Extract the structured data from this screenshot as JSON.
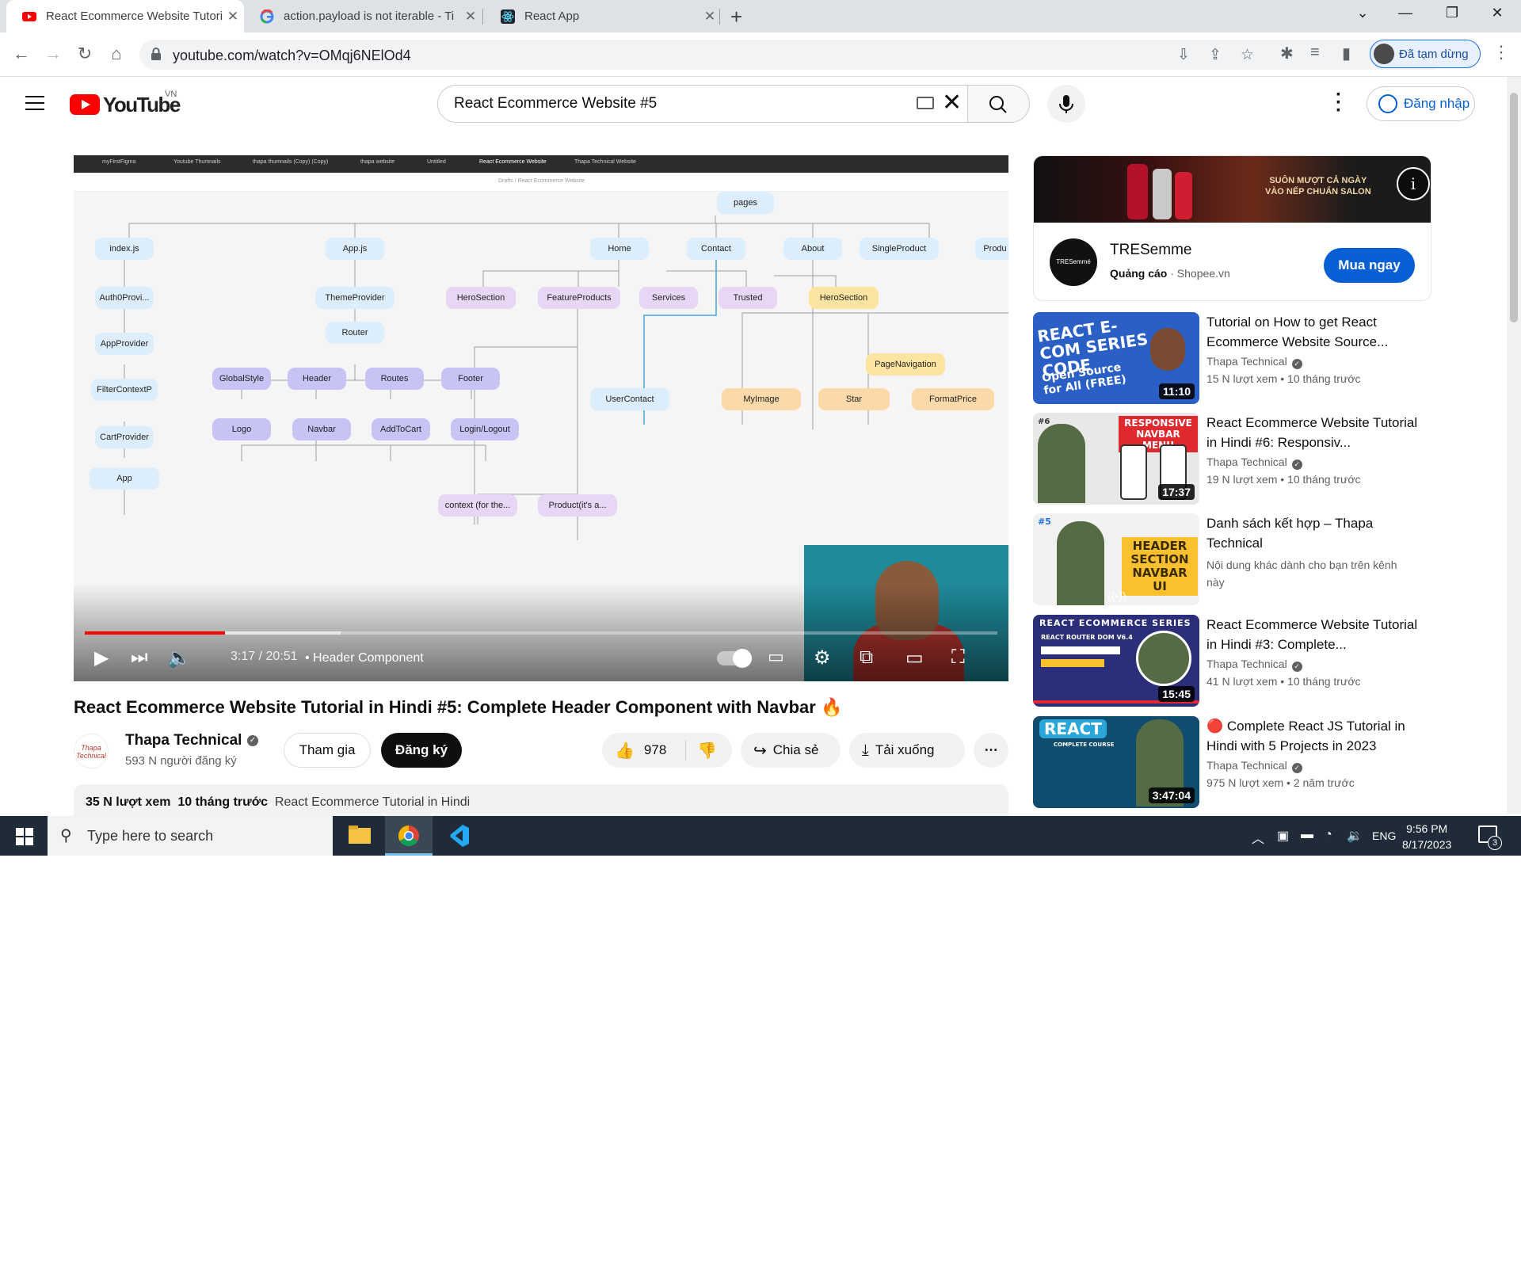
{
  "browser": {
    "tabs": [
      {
        "title": "React Ecommerce Website Tutori",
        "active": true,
        "icon": "youtube-icon"
      },
      {
        "title": "action.payload is not iterable - Ti",
        "active": false,
        "icon": "google-icon"
      },
      {
        "title": "React App",
        "active": false,
        "icon": "react-icon"
      }
    ],
    "url_host": "youtube.com",
    "url_path": "/watch?v=OMqj6NElOd4",
    "profile_label": "Đã tạm dừng"
  },
  "youtube": {
    "logo_text": "YouTube",
    "country": "VN",
    "search_value": "React Ecommerce Website #5",
    "signin_label": "Đăng nhập"
  },
  "player": {
    "figma_tabs": [
      "myFirstFigma",
      "Youtube Thumnails",
      "thapa thumnails (Copy) (Copy)",
      "thapa website",
      "Untitled",
      "React Ecommerce Website",
      "Thapa Technical Website"
    ],
    "figma_breadcrumb": "Drafts / React Ecommerce Website",
    "nodes": {
      "pages": "pages",
      "index": "index.js",
      "app": "App.js",
      "home": "Home",
      "contact": "Contact",
      "about": "About",
      "single": "SingleProduct",
      "prod": "Produ",
      "auth": "Auth0Provi...",
      "theme": "ThemeProvider",
      "hero1": "HeroSection",
      "feature": "FeatureProducts",
      "services": "Services",
      "trusted": "Trusted",
      "hero2": "HeroSection",
      "appprov": "AppProvider",
      "router": "Router",
      "pagenav": "PageNavigation",
      "filter": "FilterContextP",
      "globalstyle": "GlobalStyle",
      "header": "Header",
      "routes": "Routes",
      "footer": "Footer",
      "usercontact": "UserContact",
      "myimage": "MyImage",
      "star": "Star",
      "formatprice": "FormatPrice",
      "cart": "CartProvider",
      "logo": "Logo",
      "navbar": "Navbar",
      "addtocart": "AddToCart",
      "login": "Login/Logout",
      "appnode": "App",
      "context": "context (for the...",
      "product": "Product(it's a..."
    },
    "time": "3:17 / 20:51",
    "chapter": "• Header Component",
    "progress_fraction": 0.154
  },
  "video": {
    "title": "React Ecommerce Website Tutorial in Hindi #5: Complete Header Component with Navbar 🔥",
    "channel": "Thapa Technical",
    "avatar_text": "Thapa Technical",
    "subscribers": "593 N người đăng ký",
    "join_label": "Tham gia",
    "subscribe_label": "Đăng ký",
    "likes": "978",
    "share_label": "Chia sẻ",
    "download_label": "Tải xuống",
    "views": "35 N lượt xem",
    "date": "10 tháng trước",
    "playlist_tag": "React Ecommerce Tutorial in Hindi"
  },
  "ad": {
    "banner_line1": "SUÔN MƯỢT CẢ NGÀY",
    "banner_line2": "VÀO NẾP CHUẨN SALON",
    "logo_text": "TRESemmé",
    "name": "TRESemme",
    "label": "Quảng cáo",
    "source": "· Shopee.vn",
    "cta": "Mua ngay"
  },
  "recommendations": [
    {
      "title": "Tutorial on How to get React Ecommerce Website Source...",
      "channel": "Thapa Technical",
      "stats": "15 N lượt xem  •  10 tháng trước",
      "duration": "11:10",
      "thumb_text": "REACT E-COM SERIES CODE",
      "thumb_sub": "Open Source for All (FREE)"
    },
    {
      "title": "React Ecommerce Website Tutorial in Hindi #6: Responsiv...",
      "channel": "Thapa Technical",
      "stats": "19 N lượt xem  •  10 tháng trước",
      "duration": "17:37",
      "thumb_text": "RESPONSIVE NAVBAR MENU",
      "thumb_sub": "#6"
    },
    {
      "title": "Danh sách kết hợp – Thapa Technical",
      "desc": "Nội dung khác dành cho bạn trên kênh này",
      "thumb_text": "HEADER SECTION NAVBAR UI",
      "thumb_sub": "#5"
    },
    {
      "title": "React Ecommerce Website Tutorial in Hindi #3: Complete...",
      "channel": "Thapa Technical",
      "stats": "41 N lượt xem  •  10 tháng trước",
      "duration": "15:45",
      "thumb_text": "REACT ECOMMERCE SERIES",
      "thumb_sub": "REACT ROUTER DOM V6.4"
    },
    {
      "title": "🔴 Complete React JS Tutorial in Hindi with 5 Projects in 2023",
      "channel": "Thapa Technical",
      "stats": "975 N lượt xem  •  2 năm trước",
      "duration": "3:47:04",
      "thumb_text": "REACT",
      "thumb_sub": "COMPLETE COURSE"
    }
  ],
  "taskbar": {
    "search_placeholder": "Type here to search",
    "lang": "ENG",
    "time": "9:56 PM",
    "date": "8/17/2023",
    "notifications": "3"
  },
  "colors": {
    "accent": "#065fd4",
    "brand": "#ff0000",
    "taskbar": "#1f2b38"
  }
}
